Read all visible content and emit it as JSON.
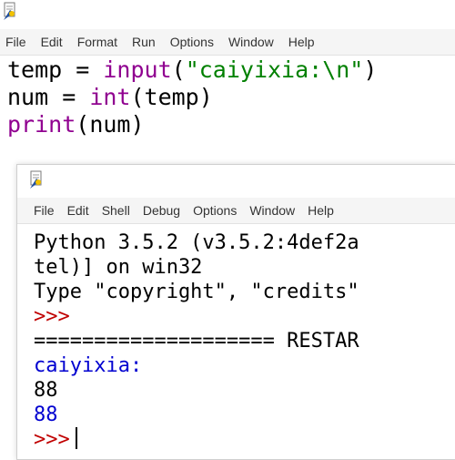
{
  "editor": {
    "menu": [
      "File",
      "Edit",
      "Format",
      "Run",
      "Options",
      "Window",
      "Help"
    ],
    "code": {
      "line1": {
        "var": "temp = ",
        "func": "input",
        "open": "(",
        "arg": "\"caiyixia:\\n\"",
        "close": ")"
      },
      "line2": {
        "var": "num = ",
        "func": "int",
        "rest": "(temp)"
      },
      "line3": {
        "func": "print",
        "rest": "(num)"
      }
    }
  },
  "shell": {
    "menu": [
      "File",
      "Edit",
      "Shell",
      "Debug",
      "Options",
      "Window",
      "Help"
    ],
    "lines": {
      "banner1": "Python 3.5.2 (v3.5.2:4def2a",
      "banner2": "tel)] on win32",
      "banner3": "Type \"copyright\", \"credits\"",
      "prompt1": ">>>",
      "restart": "==================== RESTAR",
      "input_prompt": "caiyixia:",
      "user_input": "88",
      "output": "88",
      "prompt2": ">>>"
    }
  },
  "colors": {
    "keyword": "#900090",
    "string": "#008000",
    "prompt": "#c00000",
    "stdout": "#0000d0"
  },
  "icons": [
    "idle-app-icon"
  ]
}
